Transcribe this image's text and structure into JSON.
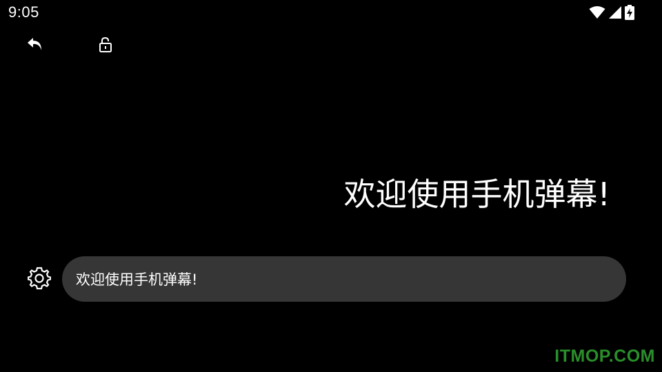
{
  "status_bar": {
    "time": "9:05",
    "icons": [
      "wifi-icon",
      "signal-icon",
      "battery-charging-icon"
    ]
  },
  "toolbar": {
    "back_icon": "back-arrow-icon",
    "lock_icon": "unlock-icon"
  },
  "danmaku": {
    "display_text": "欢迎使用手机弹幕!"
  },
  "input": {
    "value": "欢迎使用手机弹幕!",
    "settings_icon": "gear-icon"
  },
  "watermark": {
    "text": "ITMOP.COM",
    "color": "#2a8f2a"
  },
  "colors": {
    "background": "#000000",
    "input_bg": "#363636",
    "text": "#ffffff"
  }
}
